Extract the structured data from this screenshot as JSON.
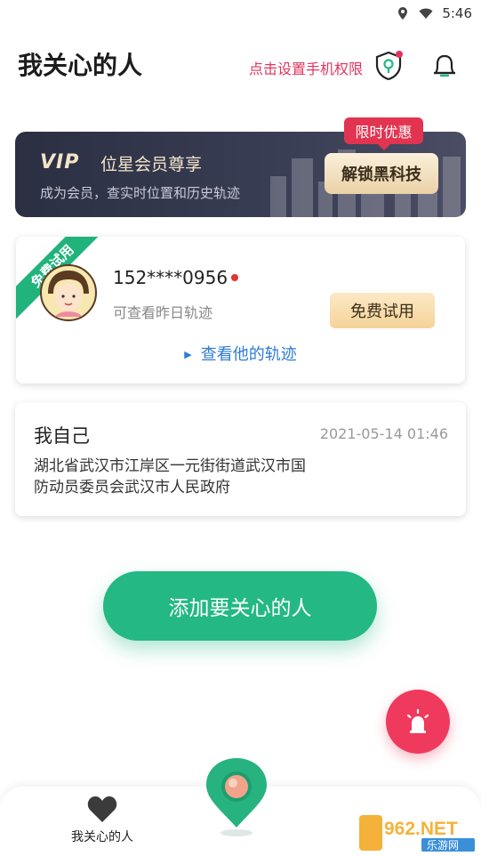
{
  "status_bar": {
    "time": "5:46",
    "icons": [
      "location-icon",
      "wifi-icon"
    ]
  },
  "header": {
    "title": "我关心的人",
    "permission_link": "点击设置手机权限",
    "icons": [
      "shield-location-icon",
      "bell-icon"
    ]
  },
  "vip": {
    "logo": "VIP",
    "title": "位星会员尊享",
    "subtitle": "成为会员，查实时位置和历史轨迹",
    "button": "解锁黑科技",
    "promo_tag": "限时优惠"
  },
  "contact": {
    "ribbon": "免费试用",
    "phone": "152****0956",
    "history_note": "可查看昨日轨迹",
    "trial_button": "免费试用",
    "view_track": "查看他的轨迹"
  },
  "self": {
    "name": "我自己",
    "time": "2021-05-14 01:46",
    "address_line1": "湖北省武汉市江岸区一元街街道武汉市国",
    "address_line2": "防动员委员会武汉市人民政府"
  },
  "add_button": "添加要关心的人",
  "nav": {
    "care_label": "我关心的人"
  },
  "watermark": {
    "brand": "962.NET",
    "sub": "乐游网"
  },
  "colors": {
    "accent_green": "#24b884",
    "alert_red": "#ef3a5d",
    "link_blue": "#2e7bd6",
    "permission_pink": "#e2345f"
  }
}
